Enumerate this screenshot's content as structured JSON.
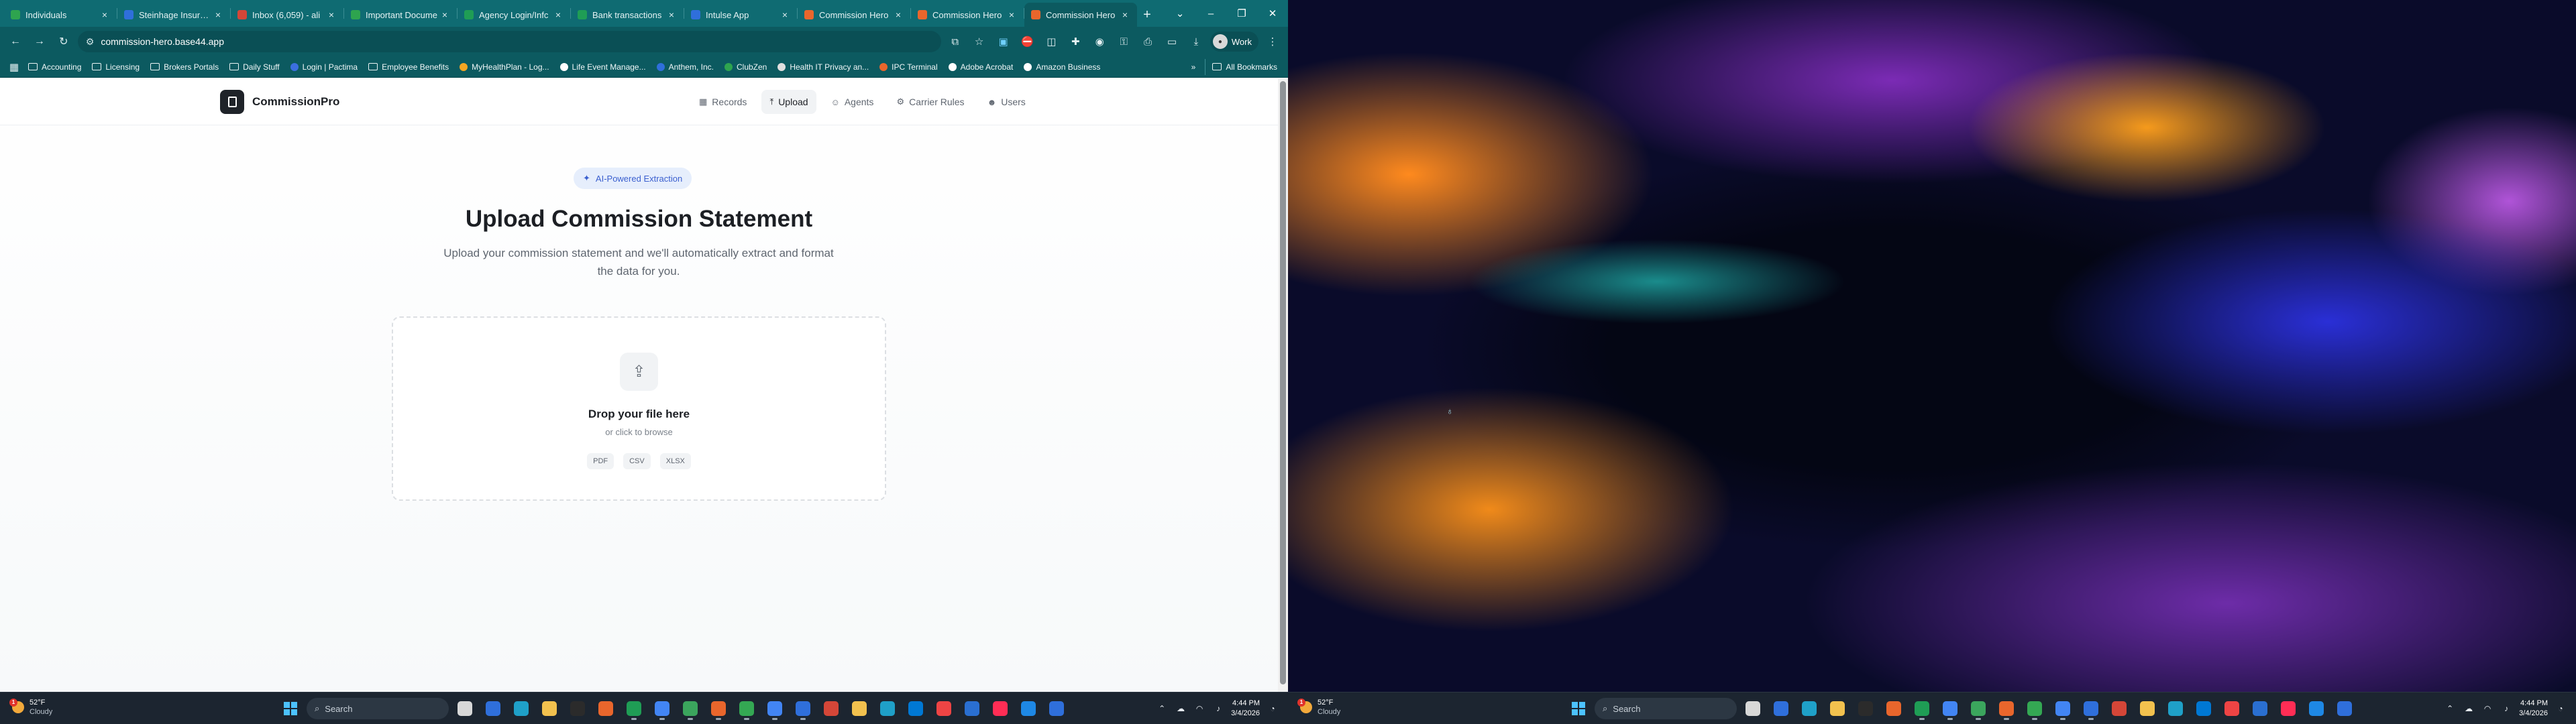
{
  "browser": {
    "tabs": [
      {
        "label": "Individuals",
        "color": "#2ea44f"
      },
      {
        "label": "Steinhage Insuranc",
        "color": "#2f6fdb"
      },
      {
        "label": "Inbox (6,059) - ali",
        "color": "#d44638"
      },
      {
        "label": "Important Docume",
        "color": "#2ea44f"
      },
      {
        "label": "Agency Login/Infc",
        "color": "#1f9d55"
      },
      {
        "label": "Bank transactions",
        "color": "#1f9d55"
      },
      {
        "label": "Intulse App",
        "color": "#2f6fdb"
      },
      {
        "label": "Commission Hero",
        "color": "#e9662c"
      },
      {
        "label": "Commission Hero",
        "color": "#e9662c"
      },
      {
        "label": "Commission Hero",
        "color": "#e9662c"
      }
    ],
    "url": "commission-hero.base44.app",
    "profile_label": "Work",
    "bookmarks": [
      {
        "label": "Accounting",
        "kind": "folder"
      },
      {
        "label": "Licensing",
        "kind": "folder"
      },
      {
        "label": "Brokers Portals",
        "kind": "folder"
      },
      {
        "label": "Daily Stuff",
        "kind": "folder"
      },
      {
        "label": "Login | Pactima",
        "kind": "site",
        "color": "#3b6fe0"
      },
      {
        "label": "Employee Benefits",
        "kind": "folder"
      },
      {
        "label": "MyHealthPlan - Log...",
        "kind": "site",
        "color": "#f5a623"
      },
      {
        "label": "Life Event Manage...",
        "kind": "site",
        "color": "#ffffff"
      },
      {
        "label": "Anthem, Inc.",
        "kind": "site",
        "color": "#2f6fdb"
      },
      {
        "label": "ClubZen",
        "kind": "site",
        "color": "#2ea44f"
      },
      {
        "label": "Health IT Privacy an...",
        "kind": "site",
        "color": "#e0e0e0"
      },
      {
        "label": "IPC Terminal",
        "kind": "site",
        "color": "#e9662c"
      },
      {
        "label": "Adobe Acrobat",
        "kind": "site",
        "color": "#ffffff"
      },
      {
        "label": "Amazon Business",
        "kind": "site",
        "color": "#ffffff"
      }
    ],
    "bookmarks_more": "»",
    "all_bookmarks": "All Bookmarks"
  },
  "app": {
    "brand": "CommissionPro",
    "nav": [
      {
        "label": "Records",
        "icon": "grid-icon",
        "glyph": "▦",
        "active": false
      },
      {
        "label": "Upload",
        "icon": "upload-icon",
        "glyph": "⤒",
        "active": true
      },
      {
        "label": "Agents",
        "icon": "user-icon",
        "glyph": "☺",
        "active": false
      },
      {
        "label": "Carrier Rules",
        "icon": "sliders-icon",
        "glyph": "⚙",
        "active": false
      },
      {
        "label": "Users",
        "icon": "users-icon",
        "glyph": "☻",
        "active": false
      }
    ],
    "badge": "AI-Powered Extraction",
    "title": "Upload Commission Statement",
    "subtitle": "Upload your commission statement and we'll automatically extract and format the data for you.",
    "dropzone": {
      "title": "Drop your file here",
      "subtitle": "or click to browse",
      "formats": [
        "PDF",
        "CSV",
        "XLSX"
      ]
    }
  },
  "taskbar": {
    "weather_temp": "52°F",
    "weather_cond": "Cloudy",
    "alert_count": "1",
    "search_placeholder": "Search",
    "time": "4:44 PM",
    "date": "3/4/2026"
  }
}
